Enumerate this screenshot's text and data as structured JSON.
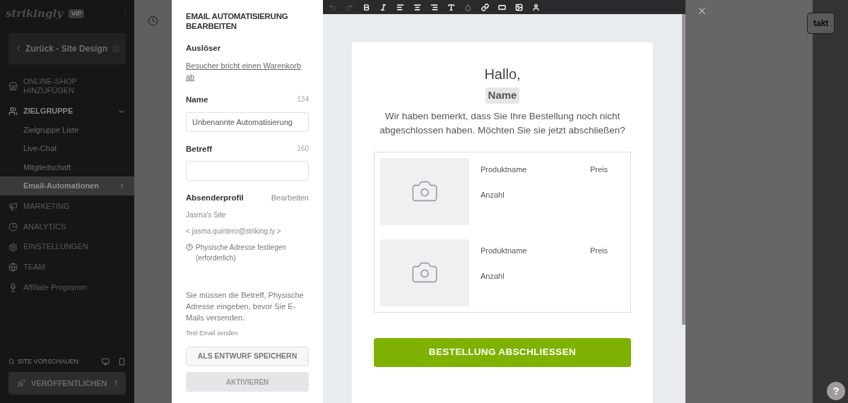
{
  "sidebar": {
    "logo": "strikingly",
    "badge": "VIP",
    "back_button": "Zurück - Site Design",
    "items": [
      {
        "kind": "section",
        "label": "ONLINE-SHOP HINZUFÜGEN",
        "selected": false
      },
      {
        "kind": "section",
        "label": "ZIELGRUPPE",
        "selected": false,
        "expanded": true,
        "children": [
          {
            "label": "Zielgruppe Liste",
            "selected": false
          },
          {
            "label": "Live-Chat",
            "selected": false
          },
          {
            "label": "Mitgliedschaft",
            "selected": false
          },
          {
            "label": "Email-Automationen",
            "selected": true
          }
        ]
      },
      {
        "kind": "section",
        "label": "MARKETING",
        "selected": false
      },
      {
        "kind": "section",
        "label": "ANALYTICS",
        "selected": false
      },
      {
        "kind": "section",
        "label": "EINSTELLUNGEN",
        "selected": false
      },
      {
        "kind": "section",
        "label": "TEAM",
        "selected": false
      },
      {
        "kind": "plain",
        "label": "Affiliate Programm",
        "selected": false
      }
    ],
    "preview_label": "SITE VORSCHAUEN",
    "publish_button": "VERÖFFENTLICHEN",
    "publish_mark": "!"
  },
  "background": {
    "contact_button": "takt"
  },
  "panel": {
    "title": "EMAIL AUTOMATISIERUNG BEARBEITEN",
    "trigger_label": "Auslöser",
    "trigger_link": "Besucher bricht einen Warenkorb ab",
    "name_label": "Name",
    "name_count": "134",
    "name_value": "Unbenannte Automatisierung",
    "subject_label": "Betreff",
    "subject_count": "160",
    "sender_label": "Absenderprofil",
    "sender_edit": "Bearbeiten",
    "sender_name": "Jasma's Site",
    "sender_email": "< jasma.quintero@striking.ly >",
    "address_note": "Physische Adresse festlegen (erforderlich)",
    "warning": "Sie müssen die Betreff, Physische Adresse eingeben, bevor Sie E-Mails versenden.",
    "test_link": "Test Email senden",
    "draft_button": "ALS ENTWURF SPEICHERN",
    "activate_button": "AKTIVIEREN",
    "activate_disabled": true
  },
  "email": {
    "greeting": "Hallo,",
    "name_tag": "Name",
    "message": "Wir haben bemerkt, dass Sie Ihre Bestellung noch nicht abgeschlossen haben. Möchten Sie sie jetzt abschließen?",
    "products": [
      {
        "name": "Produktname",
        "price": "Preis",
        "quantity": "Anzahl"
      },
      {
        "name": "Produktname",
        "price": "Preis",
        "quantity": "Anzahl"
      }
    ],
    "cta": "BESTELLUNG ABSCHLIESSEN"
  },
  "help": "?"
}
